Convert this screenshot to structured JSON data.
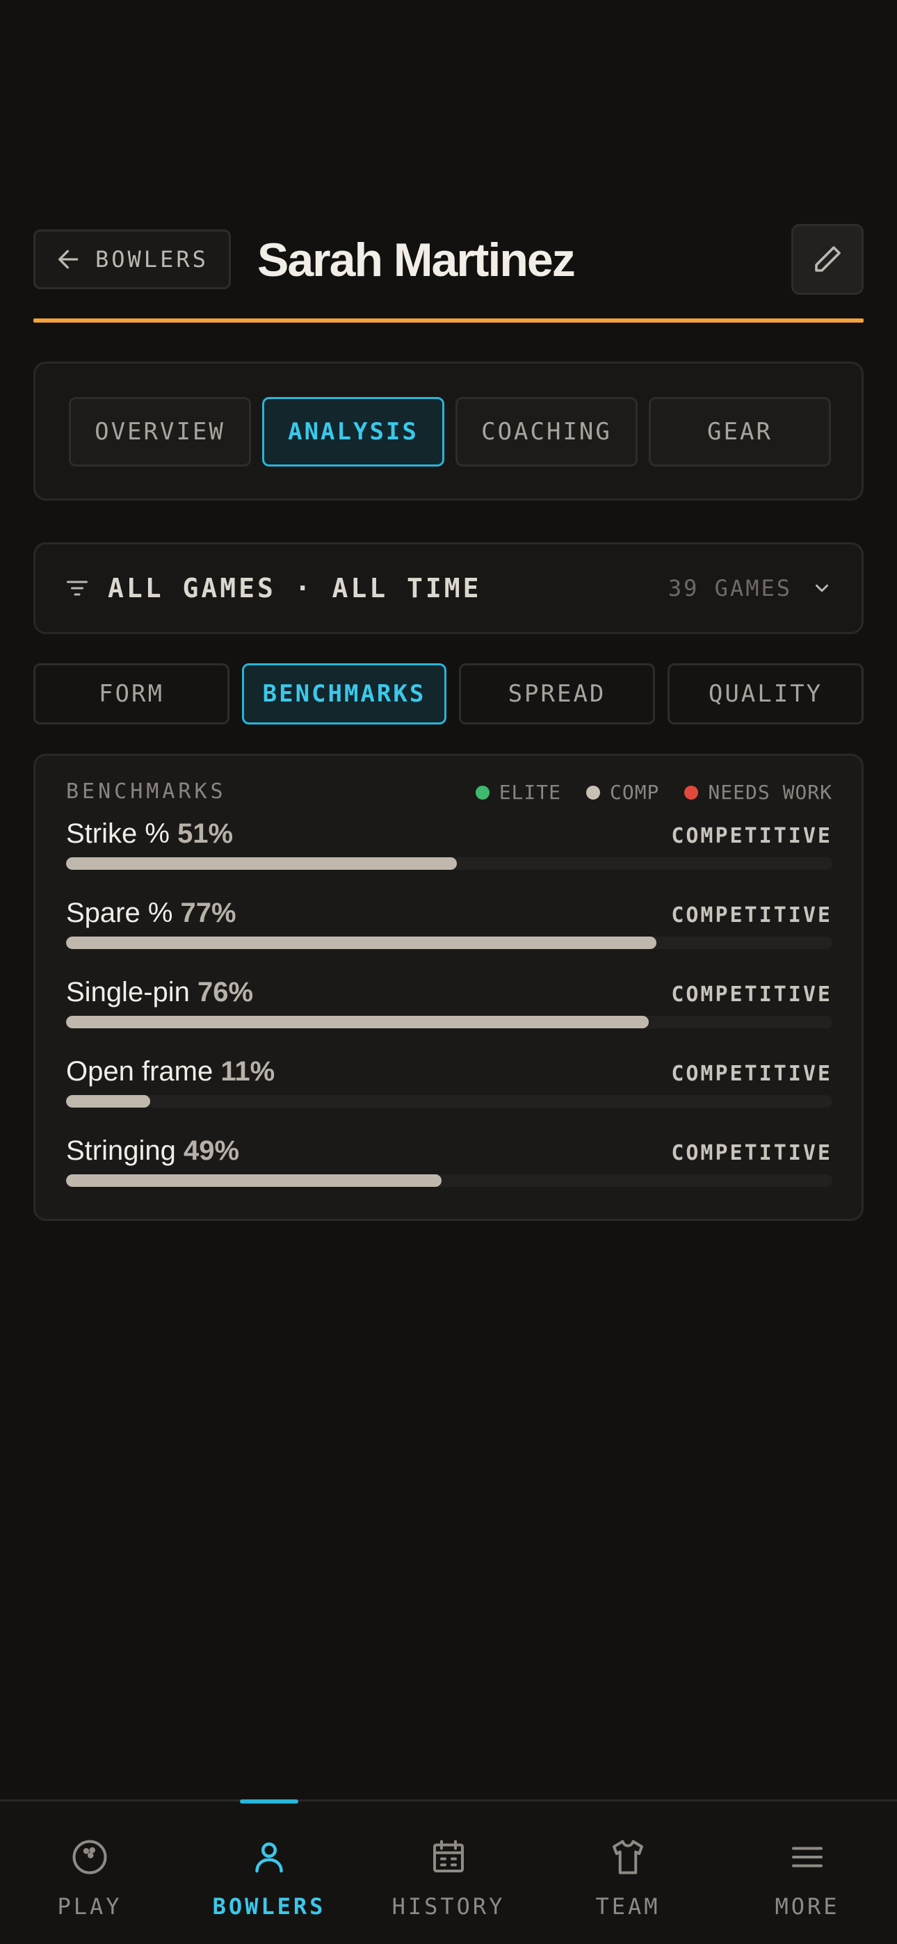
{
  "header": {
    "back_label": "BOWLERS",
    "title": "Sarah Martinez",
    "accent_color": "#f2a23b"
  },
  "tabs": [
    {
      "label": "OVERVIEW",
      "active": false
    },
    {
      "label": "ANALYSIS",
      "active": true
    },
    {
      "label": "COACHING",
      "active": false
    },
    {
      "label": "GEAR",
      "active": false
    }
  ],
  "filter": {
    "label": "ALL GAMES · ALL TIME",
    "count": "39 GAMES",
    "icon": "filter-icon"
  },
  "subtabs": [
    {
      "label": "FORM",
      "active": false
    },
    {
      "label": "BENCHMARKS",
      "active": true
    },
    {
      "label": "SPREAD",
      "active": false
    },
    {
      "label": "QUALITY",
      "active": false
    }
  ],
  "benchmarks": {
    "title": "BENCHMARKS",
    "legend": [
      {
        "label": "ELITE",
        "color": "#3fb96b"
      },
      {
        "label": "COMP",
        "color": "#c9c0b4"
      },
      {
        "label": "NEEDS WORK",
        "color": "#e2493c"
      }
    ],
    "metrics": [
      {
        "name": "Strike %",
        "value": "51%",
        "status": "COMPETITIVE",
        "fill": 0.51
      },
      {
        "name": "Spare %",
        "value": "77%",
        "status": "COMPETITIVE",
        "fill": 0.77
      },
      {
        "name": "Single-pin",
        "value": "76%",
        "status": "COMPETITIVE",
        "fill": 0.76
      },
      {
        "name": "Open frame",
        "value": "11%",
        "status": "COMPETITIVE",
        "fill": 0.11
      },
      {
        "name": "Stringing",
        "value": "49%",
        "status": "COMPETITIVE",
        "fill": 0.49
      }
    ]
  },
  "bottom_nav": [
    {
      "label": "PLAY",
      "icon": "bowling-ball-icon",
      "active": false
    },
    {
      "label": "BOWLERS",
      "icon": "person-icon",
      "active": true
    },
    {
      "label": "HISTORY",
      "icon": "calendar-icon",
      "active": false
    },
    {
      "label": "TEAM",
      "icon": "shirt-icon",
      "active": false
    },
    {
      "label": "MORE",
      "icon": "menu-icon",
      "active": false
    }
  ],
  "colors": {
    "background": "#121110",
    "active_accent": "#3bc8ea",
    "bar_fill": "#c1b8ad"
  }
}
